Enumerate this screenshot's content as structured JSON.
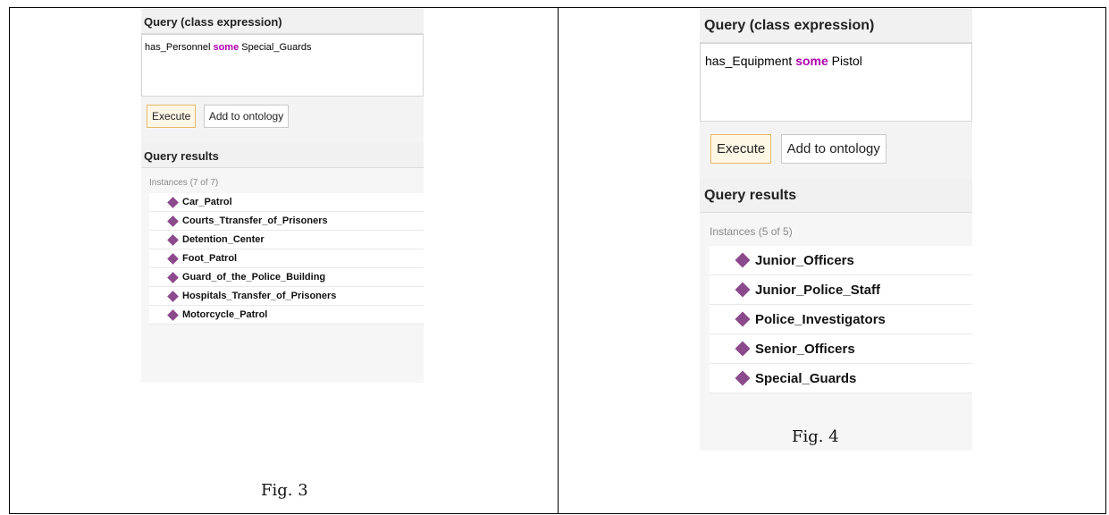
{
  "fig3": {
    "query_header": "Query (class expression)",
    "query": {
      "prefix": "has_Personnel ",
      "keyword": "some",
      "suffix": " Special_Guards"
    },
    "execute_label": "Execute",
    "add_label": "Add to ontology",
    "results_header": "Query results",
    "instances_label": "Instances (7 of 7)",
    "instances": [
      "Car_Patrol",
      "Courts_Ttransfer_of_Prisoners",
      "Detention_Center",
      "Foot_Patrol",
      "Guard_of_the_Police_Building",
      "Hospitals_Transfer_of_Prisoners",
      "Motorcycle_Patrol"
    ],
    "caption": "Fig. 3"
  },
  "fig4": {
    "query_header": "Query (class expression)",
    "query": {
      "prefix": "has_Equipment ",
      "keyword": "some",
      "suffix": " Pistol"
    },
    "execute_label": "Execute",
    "add_label": "Add to ontology",
    "results_header": "Query results",
    "instances_label": "Instances (5 of 5)",
    "instances": [
      "Junior_Officers",
      "Junior_Police_Staff",
      "Police_Investigators",
      "Senior_Officers",
      "Special_Guards"
    ],
    "caption": "Fig. 4"
  },
  "colors": {
    "keyword": "#b000b0",
    "instance_icon": "#8b4a8c",
    "execute_border": "#e6b86a"
  },
  "icons": {
    "instance": "diamond-icon"
  }
}
